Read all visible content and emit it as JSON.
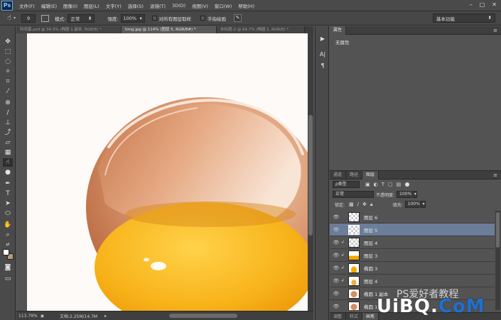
{
  "app": {
    "logo": "Ps",
    "menu": [
      "文件(F)",
      "编辑(E)",
      "图像(I)",
      "图层(L)",
      "文字(Y)",
      "选择(S)",
      "滤镜(T)",
      "3D(D)",
      "视图(V)",
      "窗口(W)",
      "帮助(H)"
    ],
    "window_controls": [
      "–",
      "□",
      "✕"
    ]
  },
  "options": {
    "brush_size": "9",
    "mode_label": "模式:",
    "mode_value": "正常",
    "strength_label": "强度:",
    "strength_value": "100%",
    "sample_all_label": "对所有图层取样",
    "finger_paint_label": "手指绘画",
    "workspace": "基本功能"
  },
  "tabs": [
    {
      "label": "科鸡蛋.psd @ 34.3% (椭圆 1 副本, RGB/8) *",
      "active": false
    },
    {
      "label": "timg.jpg @ 114% (图层 5, RGB/8#) *",
      "active": true
    },
    {
      "label": "未标题-2 @ 66.7% (椭圆 1, RGB/8) *",
      "active": false
    }
  ],
  "status": {
    "zoom": "113.79%",
    "doc": "文档:2.25M/14.7M"
  },
  "properties": {
    "tab": "属性",
    "body": "无属性"
  },
  "layers_panel": {
    "tabs": [
      "通道",
      "路径",
      "图层"
    ],
    "active_tab": "图层",
    "filter": "ρ类型",
    "blend_mode": "正常",
    "opacity_label": "不透明度:",
    "opacity_value": "100%",
    "lock_label": "锁定:",
    "fill_label": "填充:",
    "fill_value": "100%",
    "layers": [
      {
        "name": "图层 6",
        "selected": false,
        "clipped": false,
        "thumb": "transparent"
      },
      {
        "name": "图层 5",
        "selected": true,
        "clipped": false,
        "thumb": "transparent"
      },
      {
        "name": "图层 4",
        "selected": false,
        "clipped": true,
        "thumb": "transparent"
      },
      {
        "name": "图层 3",
        "selected": false,
        "clipped": true,
        "thumb": "yolk"
      },
      {
        "name": "椭圆 3",
        "selected": false,
        "clipped": true,
        "thumb": "yolk"
      },
      {
        "name": "图层 4",
        "selected": false,
        "clipped": true,
        "thumb": "yolk"
      },
      {
        "name": "椭圆 1 副本",
        "selected": false,
        "clipped": false,
        "thumb": "egg"
      },
      {
        "name": "椭圆 1",
        "selected": false,
        "clipped": false,
        "thumb": "egg"
      }
    ],
    "footer_tabs": [
      "调整",
      "样式",
      "画笔"
    ]
  },
  "watermark": {
    "cn": "PS爱好者教程",
    "logo_a": "UiBQ.",
    "logo_b": "CoM"
  },
  "colors": {
    "accent": "#6b7d99",
    "yolk": "#f5a800",
    "shell": "#d58e62"
  }
}
